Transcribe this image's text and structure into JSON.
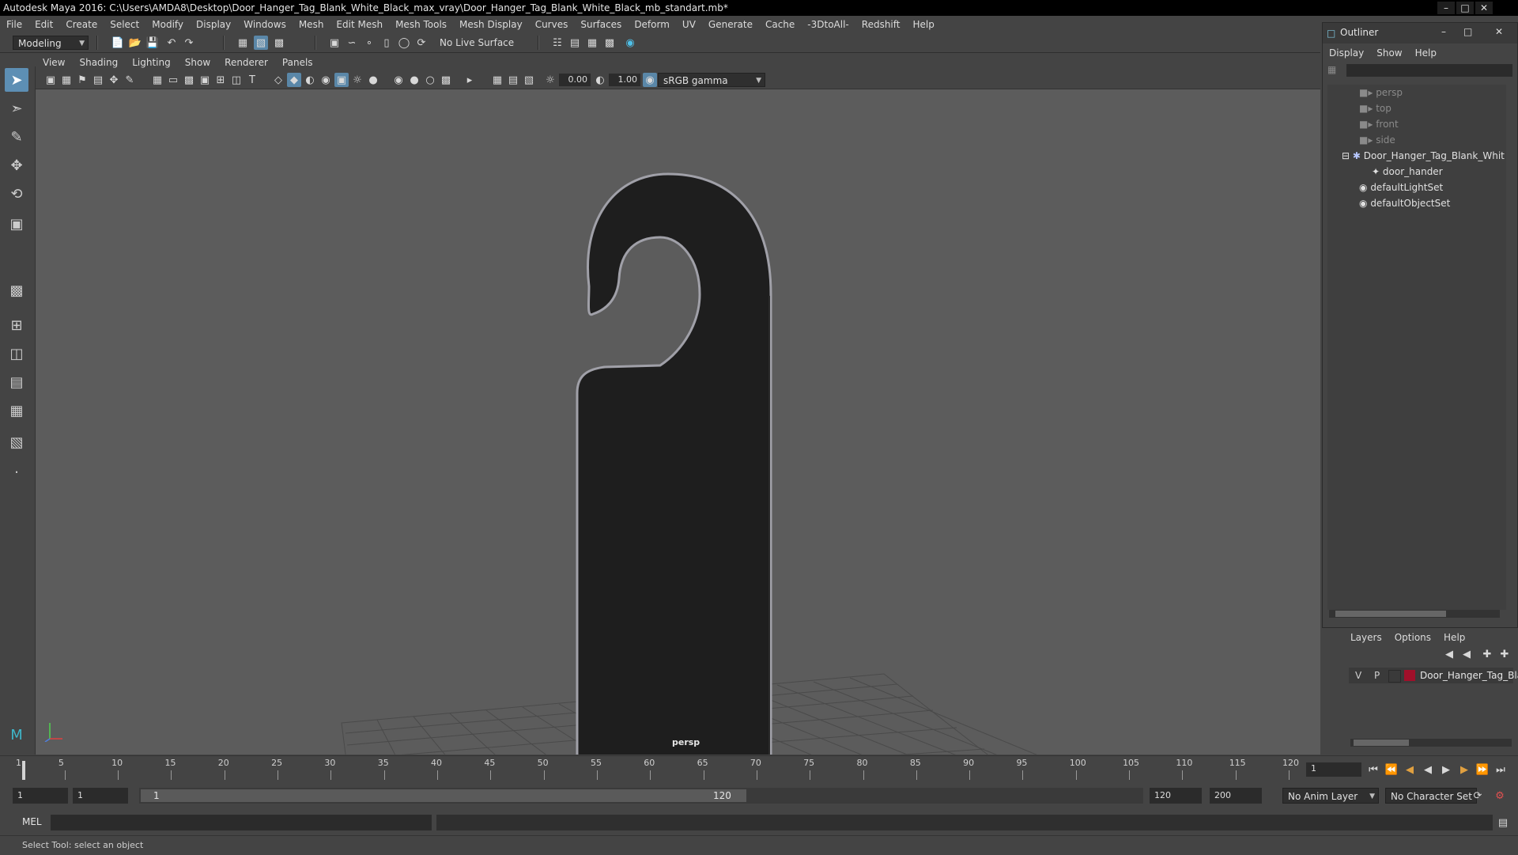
{
  "title_bar": {
    "text": "Autodesk Maya 2016: C:\\Users\\AMDA8\\Desktop\\Door_Hanger_Tag_Blank_White_Black_max_vray\\Door_Hanger_Tag_Blank_White_Black_mb_standart.mb*"
  },
  "menu": [
    "File",
    "Edit",
    "Create",
    "Select",
    "Modify",
    "Display",
    "Windows",
    "Mesh",
    "Edit Mesh",
    "Mesh Tools",
    "Mesh Display",
    "Curves",
    "Surfaces",
    "Deform",
    "UV",
    "Generate",
    "Cache",
    "-3DtoAll-",
    "Redshift",
    "Help"
  ],
  "shelf": {
    "mode": "Modeling",
    "live_surface": "No Live Surface"
  },
  "viewport": {
    "menu": [
      "View",
      "Shading",
      "Lighting",
      "Show",
      "Renderer",
      "Panels"
    ],
    "exposure": "0.00",
    "gamma": "1.00",
    "color_space": "sRGB gamma",
    "camera_label": "persp"
  },
  "outliner": {
    "title": "Outliner",
    "menu": [
      "Display",
      "Show",
      "Help"
    ],
    "items": [
      {
        "label": "persp",
        "kind": "camera"
      },
      {
        "label": "top",
        "kind": "camera"
      },
      {
        "label": "front",
        "kind": "camera"
      },
      {
        "label": "side",
        "kind": "camera"
      },
      {
        "label": "Door_Hanger_Tag_Blank_Whit",
        "kind": "group"
      },
      {
        "label": "door_hander",
        "kind": "mesh"
      },
      {
        "label": "defaultLightSet",
        "kind": "set"
      },
      {
        "label": "defaultObjectSet",
        "kind": "set"
      }
    ]
  },
  "layers": {
    "menu": [
      "Layers",
      "Options",
      "Help"
    ],
    "layer": {
      "v": "V",
      "p": "P",
      "name": "Door_Hanger_Tag_Blai",
      "color": "#a0102a"
    }
  },
  "timeline": {
    "ticks": [
      "1",
      "5",
      "10",
      "15",
      "20",
      "25",
      "30",
      "35",
      "40",
      "45",
      "50",
      "55",
      "60",
      "65",
      "70",
      "75",
      "80",
      "85",
      "90",
      "95",
      "100",
      "105",
      "110",
      "115",
      "120"
    ],
    "current_frame": "1"
  },
  "range": {
    "start": "1",
    "anim_start": "1",
    "slider_start": "1",
    "slider_end": "120",
    "end": "120",
    "anim_end": "200",
    "anim_layer": "No Anim Layer",
    "character_set": "No Character Set"
  },
  "command": {
    "label": "MEL"
  },
  "help_line": {
    "text": "Select Tool: select an object"
  }
}
